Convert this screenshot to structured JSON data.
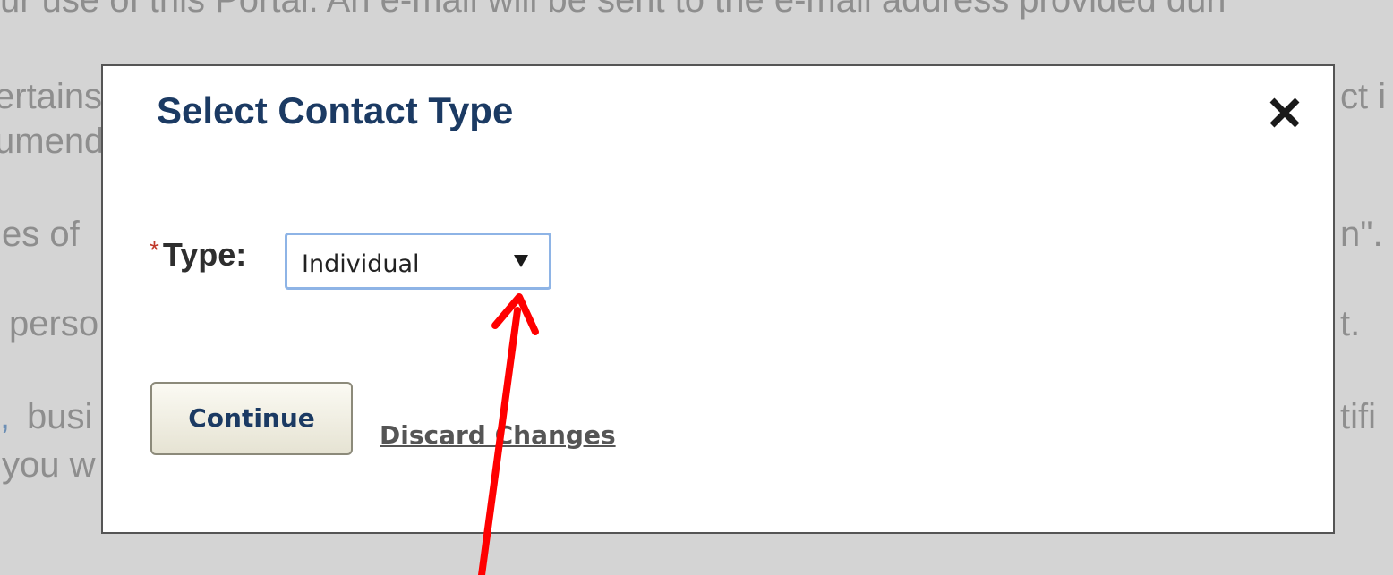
{
  "background": {
    "lines": [
      {
        "text": "ur use of this Portal. An e-mail will be sent to the e-mail address provided duri"
      },
      {
        "text": "ertains"
      },
      {
        "text": "ct i"
      },
      {
        "text": "umend"
      },
      {
        "text": "es of"
      },
      {
        "text": "n\"."
      },
      {
        "text": "perso"
      },
      {
        "text": "t."
      },
      {
        "text": ","
      },
      {
        "text": "busi"
      },
      {
        "text": "tifi"
      },
      {
        "text": "you w"
      }
    ]
  },
  "modal": {
    "title": "Select Contact Type",
    "close_icon": "close-icon",
    "required_marker": "*",
    "type_label": "Type:",
    "type_select_value": "Individual",
    "continue_label": "Continue",
    "discard_label": "Discard Changes"
  },
  "colors": {
    "title": "#1b3a63",
    "annotation_arrow": "#ff0000",
    "select_border": "#8eb4e6",
    "required_marker": "#c0392b"
  }
}
